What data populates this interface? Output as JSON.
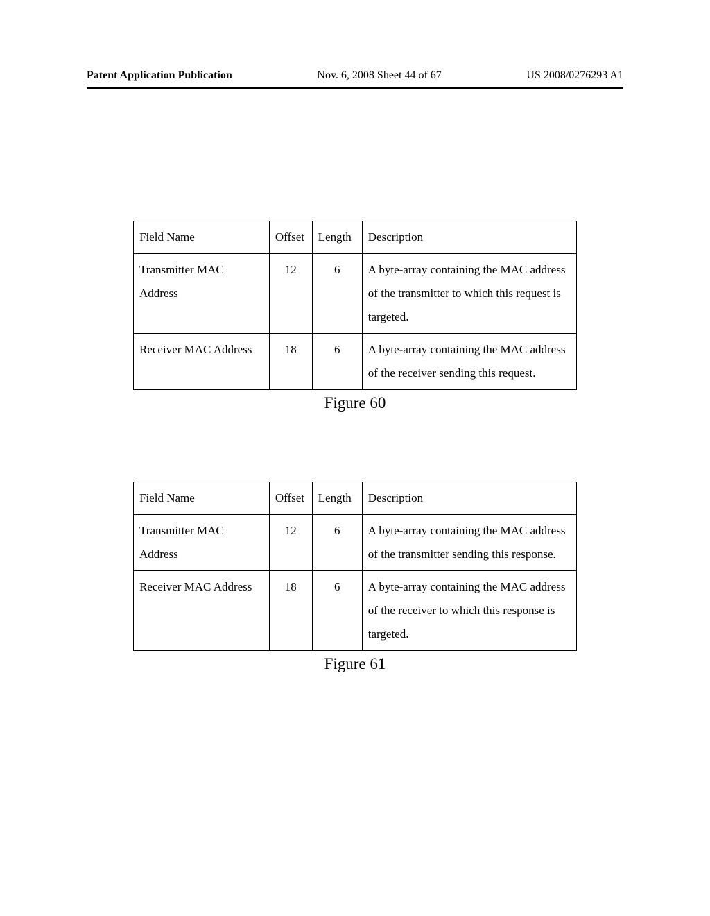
{
  "header": {
    "left": "Patent Application Publication",
    "center": "Nov. 6, 2008  Sheet 44 of 67",
    "right": "US 2008/0276293 A1"
  },
  "table60": {
    "headers": {
      "field": "Field Name",
      "offset": "Offset",
      "length": "Length",
      "desc": "Description"
    },
    "rows": [
      {
        "field": "Transmitter MAC Address",
        "offset": "12",
        "length": "6",
        "desc": "A byte-array containing the MAC address of the transmitter to which this request is targeted."
      },
      {
        "field": "Receiver MAC Address",
        "offset": "18",
        "length": "6",
        "desc": "A byte-array containing the MAC address of the receiver sending this request."
      }
    ],
    "caption": "Figure 60"
  },
  "table61": {
    "headers": {
      "field": "Field Name",
      "offset": "Offset",
      "length": "Length",
      "desc": "Description"
    },
    "rows": [
      {
        "field": "Transmitter MAC Address",
        "offset": "12",
        "length": "6",
        "desc": "A byte-array containing the MAC address of the transmitter sending this response."
      },
      {
        "field": "Receiver MAC Address",
        "offset": "18",
        "length": "6",
        "desc": "A byte-array containing the MAC address of the receiver to which this response is targeted."
      }
    ],
    "caption": "Figure 61"
  }
}
